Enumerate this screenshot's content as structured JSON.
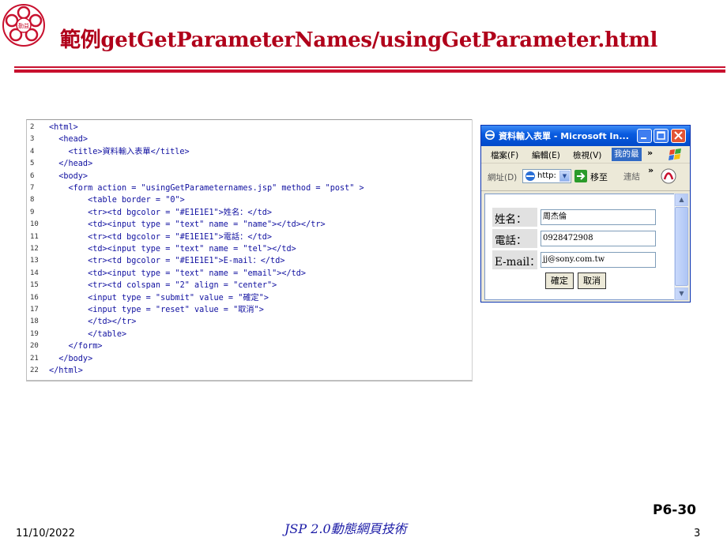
{
  "slide": {
    "title": "範例getGetParameterNames/usingGetParameter.html",
    "logo_text": "勤益"
  },
  "code": {
    "lines": [
      {
        "num": "2",
        "text": "<html>"
      },
      {
        "num": "3",
        "text": "  <head>"
      },
      {
        "num": "4",
        "text": "    <title>資料輸入表單</title>"
      },
      {
        "num": "5",
        "text": "  </head>"
      },
      {
        "num": "6",
        "text": "  <body>"
      },
      {
        "num": "7",
        "text": "    <form action = \"usingGetParameternames.jsp\" method = \"post\" >"
      },
      {
        "num": "8",
        "text": "        <table border = \"0\">"
      },
      {
        "num": "9",
        "text": "        <tr><td bgcolor = \"#E1E1E1\">姓名：</td>"
      },
      {
        "num": "10",
        "text": "        <td><input type = \"text\" name = \"name\"></td></tr>"
      },
      {
        "num": "11",
        "text": "        <tr><td bgcolor = \"#E1E1E1\">電話：</td>"
      },
      {
        "num": "12",
        "text": "        <td><input type = \"text\" name = \"tel\"></td>"
      },
      {
        "num": "13",
        "text": "        <tr><td bgcolor = \"#E1E1E1\">E-mail：</td>"
      },
      {
        "num": "14",
        "text": "        <td><input type = \"text\" name = \"email\"></td>"
      },
      {
        "num": "15",
        "text": "        <tr><td colspan = \"2\" align = \"center\">"
      },
      {
        "num": "16",
        "text": "        <input type = \"submit\" value = \"確定\">"
      },
      {
        "num": "17",
        "text": "        <input type = \"reset\" value = \"取消\">"
      },
      {
        "num": "18",
        "text": "        </td></tr>"
      },
      {
        "num": "19",
        "text": "        </table>"
      },
      {
        "num": "20",
        "text": "    </form>"
      },
      {
        "num": "21",
        "text": "  </body>"
      },
      {
        "num": "22",
        "text": "</html>"
      }
    ]
  },
  "browser": {
    "title": "資料輸入表單 - Microsoft In...",
    "menu": [
      "檔案(F)",
      "編輯(E)",
      "檢視(V)",
      "我的最"
    ],
    "chevron": "»",
    "address_label": "網址(D)",
    "address_value": "http:",
    "go_label": "移至",
    "links_label": "連結",
    "form": {
      "name_label": "姓名：",
      "name_value": "周杰倫",
      "tel_label": "電話：",
      "tel_value": "0928472908",
      "email_label": "E-mail：",
      "email_value": "jj@sony.com.tw",
      "submit_label": "確定",
      "reset_label": "取消"
    }
  },
  "footer": {
    "date": "11/10/2022",
    "center": "JSP 2.0動態網頁技術",
    "code": "P6-30",
    "page": "3"
  },
  "colors": {
    "title": "#b0001a",
    "rule": "#c8102e",
    "code_tag": "#1010a0",
    "form_cell": "#E1E1E1",
    "xp_titlebar": "#0a5ce0"
  }
}
